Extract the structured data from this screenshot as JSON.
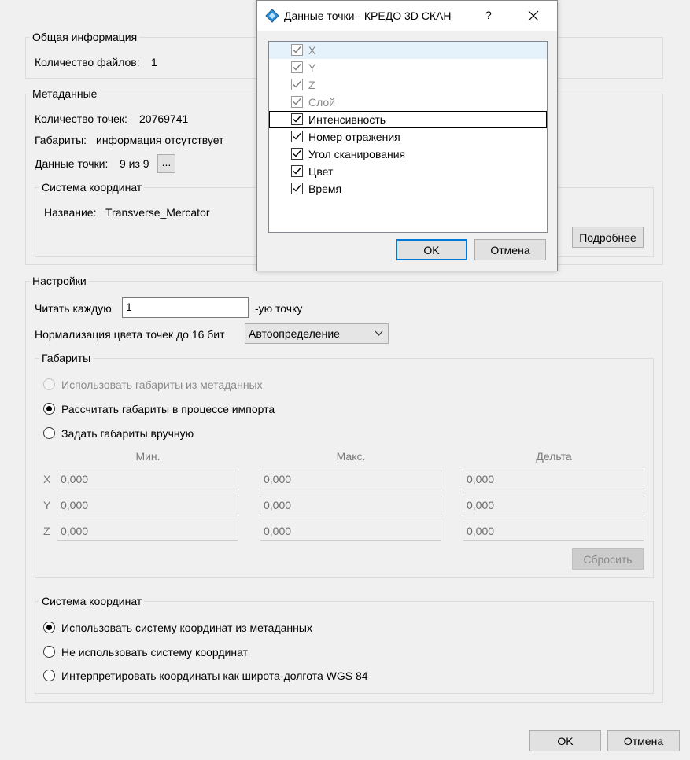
{
  "general": {
    "title": "Общая информация",
    "files_label": "Количество файлов:",
    "files_value": "1"
  },
  "metadata": {
    "title": "Метаданные",
    "points_label": "Количество точек:",
    "points_value": "20769741",
    "bounds_label": "Габариты:",
    "bounds_value": "информация отсутствует",
    "pointdata_label": "Данные точки:",
    "pointdata_value": "9 из 9",
    "pointdata_button": "...",
    "cs_title": "Система координат",
    "cs_name_label": "Название:",
    "cs_name_value": "Transverse_Mercator",
    "details_button": "Подробнее"
  },
  "settings": {
    "title": "Настройки",
    "read_every_label": "Читать каждую",
    "read_every_value": "1",
    "read_every_suffix": "-ую точку",
    "normalize_label": "Нормализация цвета точек до 16 бит",
    "normalize_value": "Автоопределение",
    "bounds": {
      "title": "Габариты",
      "opt_metadata": "Использовать габариты из метаданных",
      "opt_compute": "Рассчитать габариты в процессе импорта",
      "opt_manual": "Задать габариты вручную",
      "col_min": "Мин.",
      "col_max": "Макс.",
      "col_delta": "Дельта",
      "rows": [
        {
          "label": "X",
          "min": "0,000",
          "max": "0,000",
          "delta": "0,000"
        },
        {
          "label": "Y",
          "min": "0,000",
          "max": "0,000",
          "delta": "0,000"
        },
        {
          "label": "Z",
          "min": "0,000",
          "max": "0,000",
          "delta": "0,000"
        }
      ],
      "reset_button": "Сбросить"
    },
    "cs": {
      "title": "Система координат",
      "opt_use": "Использовать систему координат из метаданных",
      "opt_none": "Не использовать систему координат",
      "opt_wgs": "Интерпретировать координаты как широта-долгота WGS 84"
    }
  },
  "footer": {
    "ok": "OK",
    "cancel": "Отмена"
  },
  "dialog": {
    "title": "Данные точки - КРЕДО 3D СКАН",
    "help": "?",
    "close": "✕",
    "items": [
      {
        "label": "X",
        "checked": true,
        "enabled": false
      },
      {
        "label": "Y",
        "checked": true,
        "enabled": false
      },
      {
        "label": "Z",
        "checked": true,
        "enabled": false
      },
      {
        "label": "Слой",
        "checked": true,
        "enabled": false
      },
      {
        "label": "Интенсивность",
        "checked": true,
        "enabled": true
      },
      {
        "label": "Номер отражения",
        "checked": true,
        "enabled": true
      },
      {
        "label": "Угол сканирования",
        "checked": true,
        "enabled": true
      },
      {
        "label": "Цвет",
        "checked": true,
        "enabled": true
      },
      {
        "label": "Время",
        "checked": true,
        "enabled": true
      }
    ],
    "ok": "OK",
    "cancel": "Отмена",
    "accent": "#0078d7"
  }
}
